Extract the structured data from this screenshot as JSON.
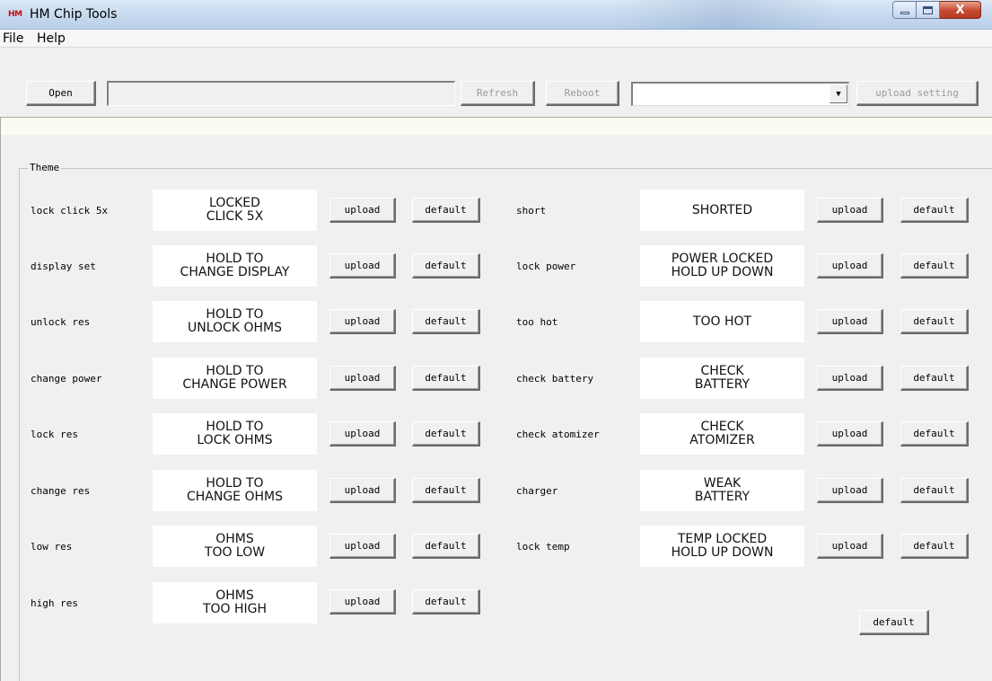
{
  "window": {
    "logo_text": "HM",
    "title": "HM Chip Tools",
    "controls": {
      "minimize": "minimize",
      "maximize": "maximize",
      "close": "X"
    }
  },
  "menu": {
    "items": [
      "File",
      "Help"
    ]
  },
  "toolbar": {
    "open_label": "Open",
    "path_value": "",
    "refresh_label": "Refresh",
    "reboot_label": "Reboot",
    "device_select_value": "",
    "upload_setting_label": "upload setting"
  },
  "status": {
    "text": ""
  },
  "theme": {
    "legend": "Theme",
    "upload_label": "upload",
    "default_label": "default",
    "global_default_label": "default",
    "left_rows": [
      {
        "label": "lock click 5x",
        "value": "LOCKED\nCLICK 5X"
      },
      {
        "label": "display set",
        "value": "HOLD TO\nCHANGE DISPLAY"
      },
      {
        "label": "unlock res",
        "value": "HOLD TO\nUNLOCK OHMS"
      },
      {
        "label": "change power",
        "value": "HOLD TO\nCHANGE POWER"
      },
      {
        "label": "lock res",
        "value": "HOLD TO\nLOCK OHMS"
      },
      {
        "label": "change res",
        "value": "HOLD TO\nCHANGE OHMS"
      },
      {
        "label": "low res",
        "value": "OHMS\nTOO LOW"
      },
      {
        "label": "high res",
        "value": "OHMS\nTOO HIGH"
      }
    ],
    "right_rows": [
      {
        "label": "short",
        "value": "SHORTED"
      },
      {
        "label": "lock power",
        "value": "POWER LOCKED\nHOLD UP DOWN"
      },
      {
        "label": "too hot",
        "value": "TOO HOT"
      },
      {
        "label": "check battery",
        "value": "CHECK\nBATTERY"
      },
      {
        "label": "check atomizer",
        "value": "CHECK\nATOMIZER"
      },
      {
        "label": "charger",
        "value": "WEAK\nBATTERY"
      },
      {
        "label": "lock temp",
        "value": "TEMP LOCKED\nHOLD UP DOWN"
      }
    ]
  },
  "colors": {
    "background": "#f0f0f0",
    "titlebar": "#c6d9ee",
    "close_button": "#c44a31",
    "logo": "#c61010",
    "status_strip": "#fbfbf1"
  }
}
